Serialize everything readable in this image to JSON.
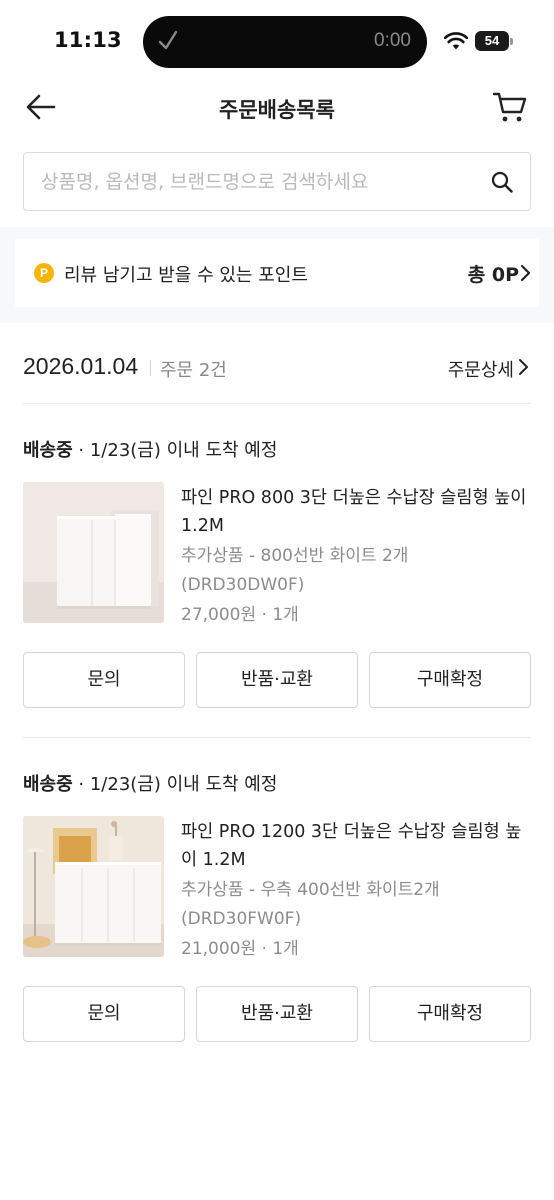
{
  "status_bar": {
    "time": "11:13",
    "media_timer": "0:00",
    "battery": "54"
  },
  "header": {
    "title": "주문배송목록"
  },
  "search": {
    "placeholder": "상품명, 옵션명, 브랜드명으로 검색하세요"
  },
  "points": {
    "coin": "P",
    "label": "리뷰 남기고 받을 수 있는 포인트",
    "total": "총 0P"
  },
  "order": {
    "date": "2026.01.04",
    "count": "주문 2건",
    "detail_link": "주문상세"
  },
  "shipments": [
    {
      "status": "배송중",
      "eta": " · 1/23(금) 이내 도착 예정",
      "product_name": "파인 PRO 800 3단 더높은 수납장 슬림형 높이 1.2M",
      "option": "추가상품 - 800선반 화이트 2개 (DRD30DW0F)",
      "price": "27,000원 · 1개",
      "buttons": [
        "문의",
        "반품·교환",
        "구매확정"
      ]
    },
    {
      "status": "배송중",
      "eta": " · 1/23(금) 이내 도착 예정",
      "product_name": "파인 PRO 1200 3단 더높은 수납장 슬림형 높이 1.2M",
      "option": "추가상품 - 우측 400선반 화이트2개 (DRD30FW0F)",
      "price": "21,000원 · 1개",
      "buttons": [
        "문의",
        "반품·교환",
        "구매확정"
      ]
    }
  ],
  "colors": {
    "point_coin": "#f6b500",
    "banner_bg": "#f7f8fa",
    "muted_text": "#8c8c8c"
  }
}
